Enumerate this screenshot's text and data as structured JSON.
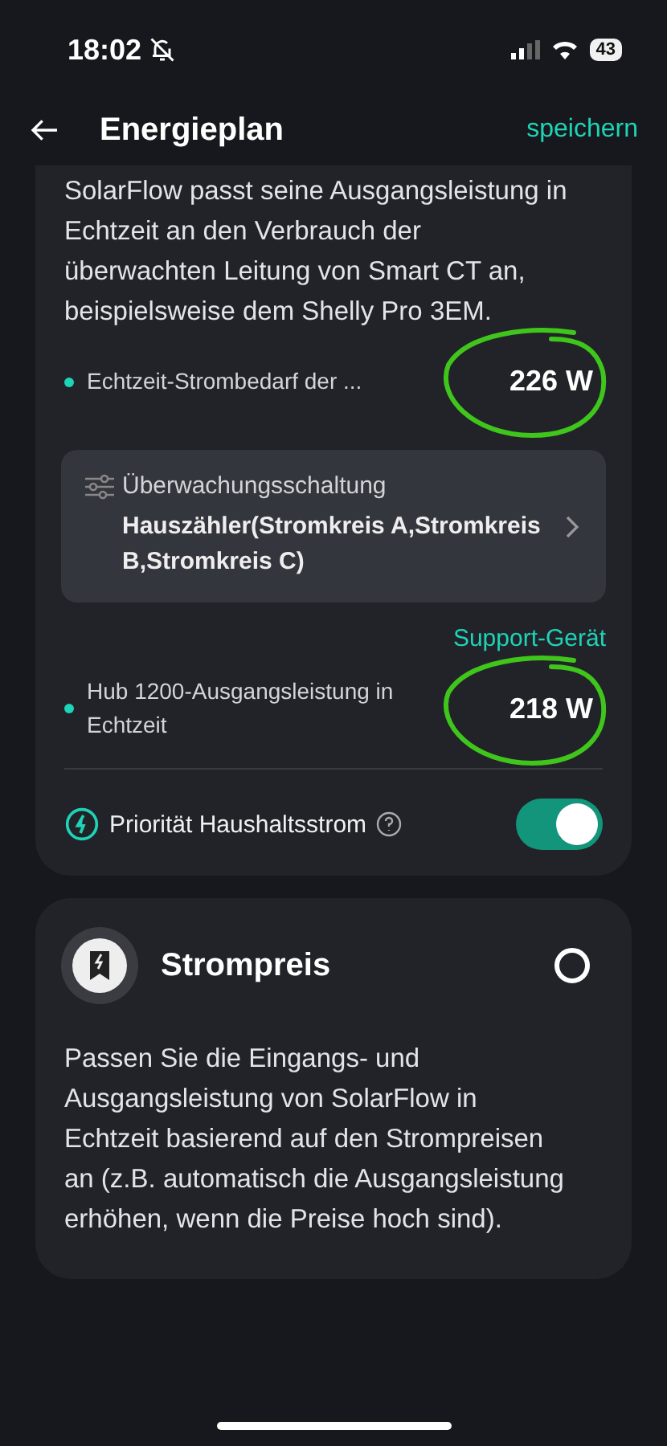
{
  "status_bar": {
    "time": "18:02",
    "battery": "43"
  },
  "header": {
    "title": "Energieplan",
    "action": "speichern"
  },
  "smart_ct_card": {
    "description": "SolarFlow passt seine Ausgangsleistung in Echtzeit an den Verbrauch der überwachten Leitung von Smart CT an, beispielsweise dem Shelly Pro 3EM.",
    "demand": {
      "label": "Echtzeit-Strombedarf der ...",
      "value": "226 W",
      "circled": true
    },
    "circuit": {
      "title": "Überwachungsschaltung",
      "value": "Hauszähler(Stromkreis A,Stromkreis B,Stromkreis C)"
    },
    "support_link": "Support-Gerät",
    "output": {
      "label": "Hub 1200-Ausgangsleistung in Echtzeit",
      "value": "218 W",
      "circled": true
    },
    "priority": {
      "label": "Priorität Haushaltsstrom",
      "on": true
    }
  },
  "price_card": {
    "title": "Strompreis",
    "selected": false,
    "description": "Passen Sie die Eingangs- und Ausgangsleistung von SolarFlow in Echtzeit basierend auf den Strompreisen an (z.B. automatisch die Ausgangsleistung erhöhen, wenn die Preise hoch sind)."
  }
}
